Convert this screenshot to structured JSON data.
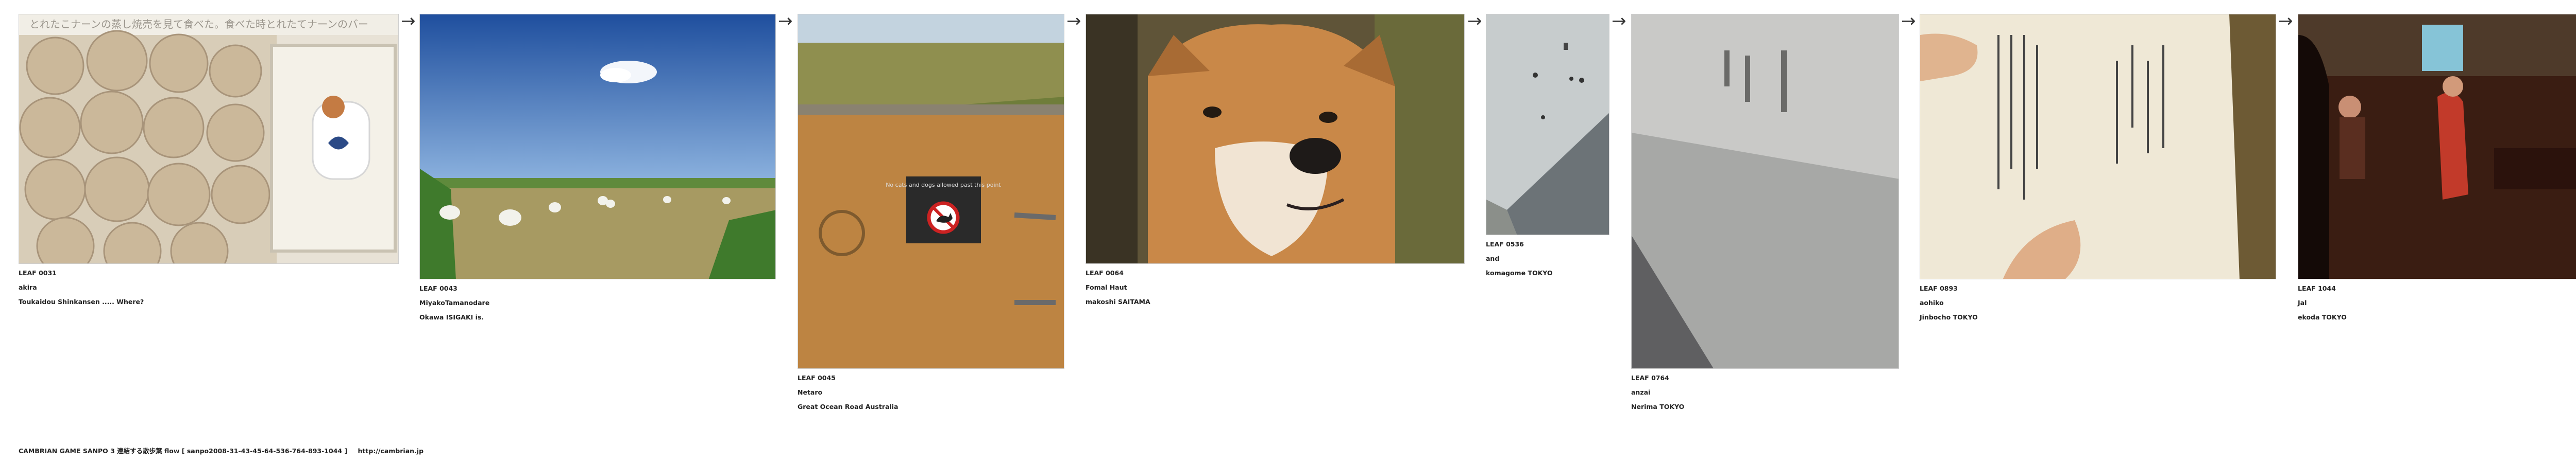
{
  "leaves": [
    {
      "id": "LEAF 0031",
      "author": "akira",
      "place": "Toukaidou Shinkansen ..... Where?",
      "photo": "shumai-box-photo"
    },
    {
      "id": "LEAF 0043",
      "author": "MiyakoTamanodare",
      "place": "Okawa ISIGAKI is.",
      "photo": "grass-field-photo"
    },
    {
      "id": "LEAF 0045",
      "author": "Netaro",
      "place": "Great Ocean Road Australia",
      "photo": "no-dogs-sign-photo"
    },
    {
      "id": "LEAF 0064",
      "author": "Fomal Haut",
      "place": "makoshi SAITAMA",
      "photo": "shiba-dog-photo"
    },
    {
      "id": "LEAF 0536",
      "author": "and",
      "place": "komagome TOKYO",
      "photo": "concrete-corner-photo"
    },
    {
      "id": "LEAF 0764",
      "author": "anzai",
      "place": "Nerima TOKYO",
      "photo": "concrete-wall-photo"
    },
    {
      "id": "LEAF 0893",
      "author": "aohiko",
      "place": "Jinbocho  TOKYO",
      "photo": "open-book-photo"
    },
    {
      "id": "LEAF 1044",
      "author": "Jal",
      "place": "ekoda TOKYO",
      "photo": "cafe-interior-photo"
    }
  ],
  "photo_texts": {
    "box_label": "とれたこナーンの蒸し焼売を見て食べた。食べた時とれたてナーンのバー",
    "sign": "No cats and dogs allowed past this point"
  },
  "arrow_symbol": "→",
  "footer": {
    "title": "CAMBRIAN GAME  SANPO 3 連結する散歩葉 flow [ sanpo2008-31-43-45-64-536-764-893-1044 ]",
    "url": "http://cambrian.jp"
  }
}
